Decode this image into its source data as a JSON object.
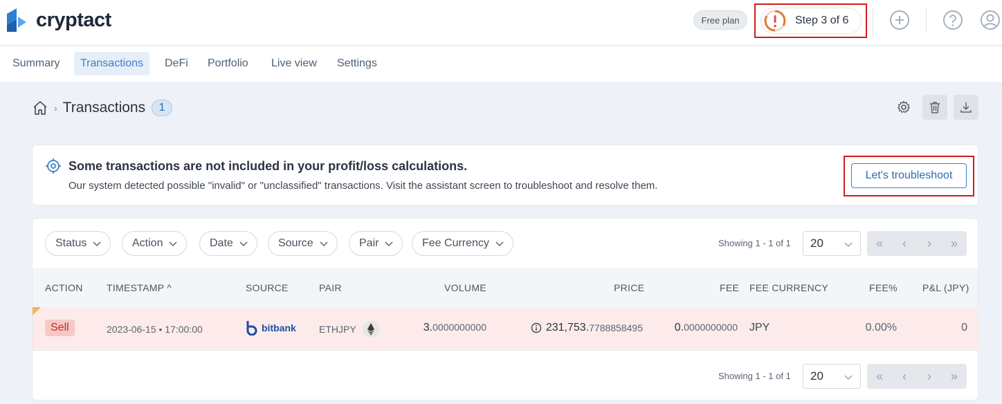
{
  "app": {
    "name": "cryptact"
  },
  "header": {
    "plan": "Free plan",
    "step": "Step 3 of 6"
  },
  "nav": {
    "items": [
      "Summary",
      "Transactions",
      "DeFi",
      "Portfolio",
      "Live view",
      "Settings"
    ],
    "active": "Transactions"
  },
  "breadcrumb": {
    "title": "Transactions",
    "count": "1"
  },
  "alert": {
    "title": "Some transactions are not included in your profit/loss calculations.",
    "body": "Our system detected possible \"invalid\" or \"unclassified\" transactions. Visit the assistant screen to troubleshoot and resolve them.",
    "button": "Let's troubleshoot"
  },
  "filters": [
    "Status",
    "Action",
    "Date",
    "Source",
    "Pair",
    "Fee Currency"
  ],
  "pagination": {
    "showing": "Showing 1 - 1 of 1",
    "per_page": "20"
  },
  "columns": {
    "action": "ACTION",
    "timestamp": "TIMESTAMP",
    "source": "SOURCE",
    "pair": "PAIR",
    "volume": "VOLUME",
    "price": "PRICE",
    "fee": "FEE",
    "fee_currency": "FEE CURRENCY",
    "fee_pct": "FEE%",
    "pl": "P&L (JPY)"
  },
  "rows": [
    {
      "action": "Sell",
      "timestamp": "2023-06-15 • 17:00:00",
      "source": "bitbank",
      "pair": "ETHJPY",
      "volume_int": "3.",
      "volume_dec": "0000000000",
      "price_int": "231,753.",
      "price_dec": "7788858495",
      "fee_int": "0.",
      "fee_dec": "0000000000",
      "fee_currency": "JPY",
      "fee_pct": "0.00%",
      "pl": "0"
    }
  ],
  "colors": {
    "accent": "#3b82c4",
    "highlight": "#d11a1a",
    "sell": "#c62828",
    "row_bg": "#fcebea"
  },
  "icons": [
    "home-icon",
    "gear-icon",
    "trash-icon",
    "download-icon",
    "target-icon",
    "info-icon",
    "eth-icon",
    "add-icon",
    "help-icon",
    "user-icon"
  ]
}
